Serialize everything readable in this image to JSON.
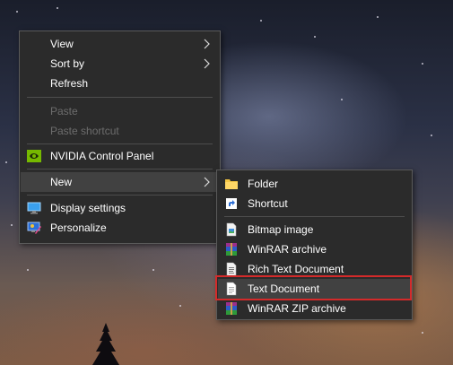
{
  "context_menu": {
    "items": [
      {
        "label": "View"
      },
      {
        "label": "Sort by"
      },
      {
        "label": "Refresh"
      },
      {
        "label": "Paste"
      },
      {
        "label": "Paste shortcut"
      },
      {
        "label": "NVIDIA Control Panel"
      },
      {
        "label": "New"
      },
      {
        "label": "Display settings"
      },
      {
        "label": "Personalize"
      }
    ]
  },
  "new_submenu": {
    "items": [
      {
        "label": "Folder"
      },
      {
        "label": "Shortcut"
      },
      {
        "label": "Bitmap image"
      },
      {
        "label": "WinRAR archive"
      },
      {
        "label": "Rich Text Document"
      },
      {
        "label": "Text Document"
      },
      {
        "label": "WinRAR ZIP archive"
      }
    ]
  },
  "icons": {
    "nvidia": "nvidia-icon",
    "display": "display-settings-icon",
    "personalize": "personalize-icon",
    "folder": "folder-icon",
    "shortcut": "shortcut-icon",
    "bitmap": "bitmap-image-icon",
    "winrar": "winrar-archive-icon",
    "rtf": "rich-text-document-icon",
    "txt": "text-document-icon",
    "zip": "winrar-zip-archive-icon"
  },
  "colors": {
    "menu_background": "#2b2b2b",
    "hover_background": "#414141",
    "highlight_border": "#d42a2a",
    "disabled_text": "#6d6d6d"
  }
}
